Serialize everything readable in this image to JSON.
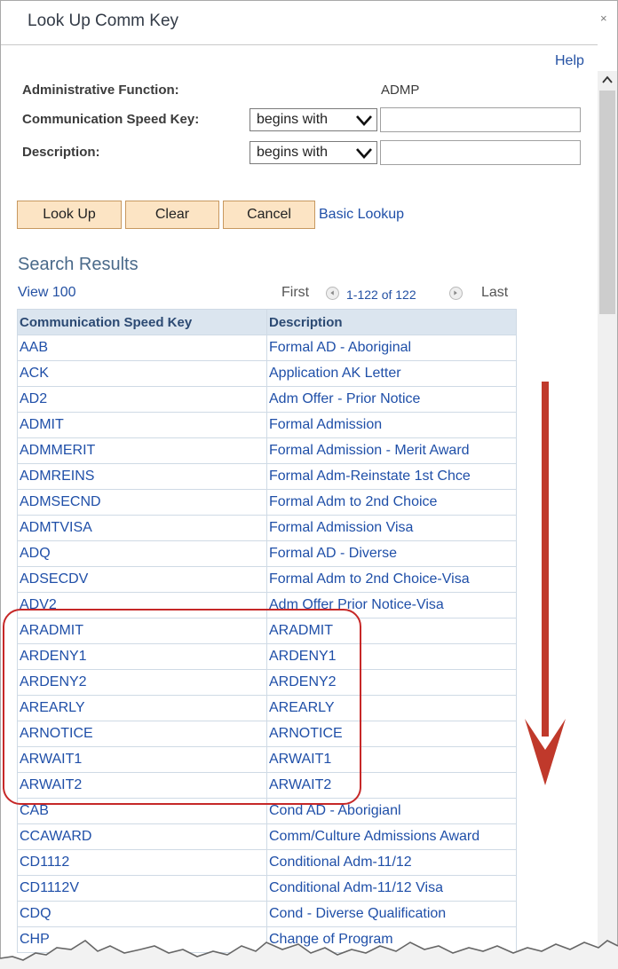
{
  "window": {
    "title": "Look Up Comm Key",
    "close_glyph": "×"
  },
  "help_label": "Help",
  "criteria": {
    "admin_function_label": "Administrative Function:",
    "admin_function_value": "ADMP",
    "speed_key_label": "Communication Speed Key:",
    "speed_key_operator": "begins with",
    "speed_key_value": "",
    "description_label": "Description:",
    "description_operator": "begins with",
    "description_value": ""
  },
  "buttons": {
    "lookup": "Look Up",
    "clear": "Clear",
    "cancel": "Cancel",
    "basic_lookup": "Basic Lookup"
  },
  "results": {
    "title": "Search Results",
    "view_label": "View 100",
    "first_label": "First",
    "range": "1-122 of 122",
    "last_label": "Last",
    "columns": [
      "Communication Speed Key",
      "Description"
    ],
    "rows": [
      [
        "AAB",
        "Formal AD - Aboriginal"
      ],
      [
        "ACK",
        "Application AK Letter"
      ],
      [
        "AD2",
        "Adm Offer - Prior Notice"
      ],
      [
        "ADMIT",
        "Formal Admission"
      ],
      [
        "ADMMERIT",
        "Formal Admission - Merit Award"
      ],
      [
        "ADMREINS",
        "Formal Adm-Reinstate 1st Chce"
      ],
      [
        "ADMSECND",
        "Formal Adm to 2nd Choice"
      ],
      [
        "ADMTVISA",
        "Formal Admission Visa"
      ],
      [
        "ADQ",
        "Formal AD - Diverse"
      ],
      [
        "ADSECDV",
        "Formal Adm to 2nd Choice-Visa"
      ],
      [
        "ADV2",
        "Adm Offer Prior Notice-Visa"
      ],
      [
        "ARADMIT",
        "ARADMIT"
      ],
      [
        "ARDENY1",
        "ARDENY1"
      ],
      [
        "ARDENY2",
        "ARDENY2"
      ],
      [
        "AREARLY",
        "AREARLY"
      ],
      [
        "ARNOTICE",
        "ARNOTICE"
      ],
      [
        "ARWAIT1",
        "ARWAIT1"
      ],
      [
        "ARWAIT2",
        "ARWAIT2"
      ],
      [
        "CAB",
        "Cond AD - Aborigianl"
      ],
      [
        "CCAWARD",
        "Comm/Culture Admissions Award"
      ],
      [
        "CD1112",
        "Conditional Adm-11/12"
      ],
      [
        "CD1112V",
        "Conditional Adm-11/12 Visa"
      ],
      [
        "CDQ",
        "Cond - Diverse Qualification"
      ],
      [
        "CHP",
        "Change of Program"
      ]
    ]
  },
  "colors": {
    "link": "#1f4fa8",
    "header_bg": "#dbe5ef",
    "button_bg": "#fce4c4",
    "annotation": "#c62828"
  }
}
